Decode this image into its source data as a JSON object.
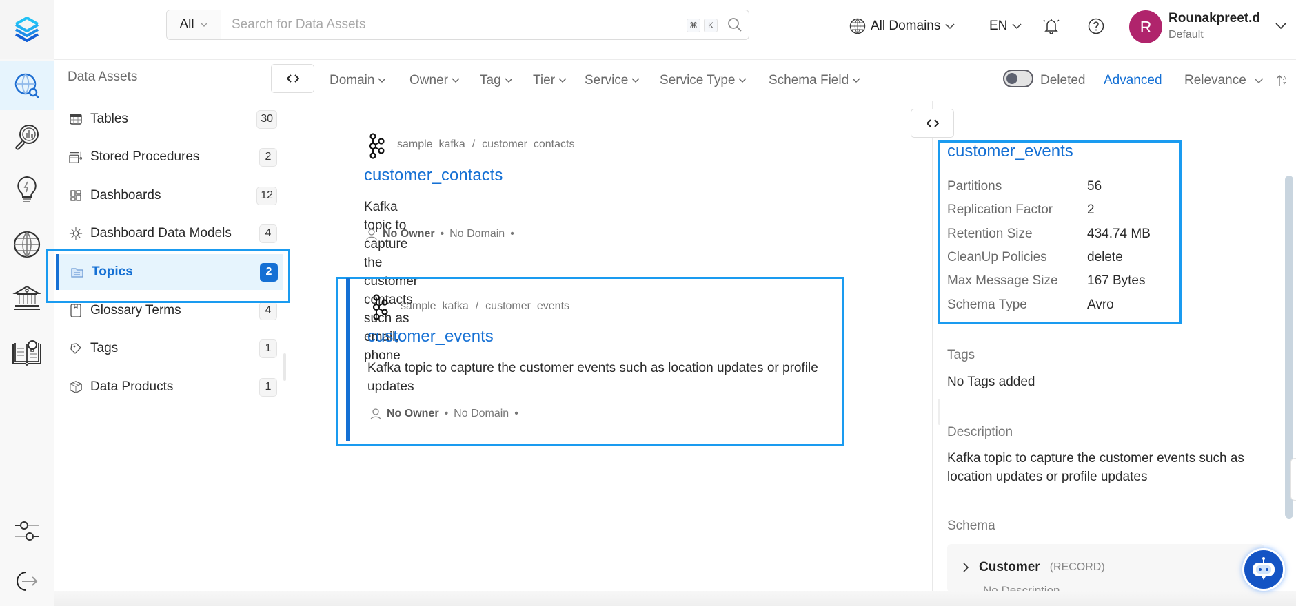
{
  "header": {
    "search_type": "All",
    "search_placeholder": "Search for Data Assets",
    "search_value": "",
    "shortcut_keys": [
      "⌘",
      "K"
    ],
    "domain_selector": "All Domains",
    "language": "EN",
    "user": {
      "initial": "R",
      "name": "Rounakpreet.d",
      "role": "Default",
      "avatar_color": "#b0246c"
    }
  },
  "rail": {
    "items": [
      {
        "icon": "explore-icon",
        "active": true
      },
      {
        "icon": "data-insights-icon",
        "active": false
      },
      {
        "icon": "data-quality-icon",
        "active": false
      },
      {
        "icon": "domains-icon",
        "active": false
      },
      {
        "icon": "governance-icon",
        "active": false
      },
      {
        "icon": "knowledge-center-icon",
        "active": false
      }
    ],
    "bottom_items": [
      {
        "icon": "settings-sliders-icon"
      },
      {
        "icon": "logout-icon"
      }
    ]
  },
  "sidebar": {
    "title": "Data Assets",
    "items": [
      {
        "label": "Tables",
        "count": "30",
        "icon": "table-icon",
        "active": false
      },
      {
        "label": "Stored Procedures",
        "count": "2",
        "icon": "stored-procedure-icon",
        "active": false
      },
      {
        "label": "Dashboards",
        "count": "12",
        "icon": "dashboard-icon",
        "active": false
      },
      {
        "label": "Dashboard Data Models",
        "count": "4",
        "icon": "data-model-icon",
        "active": false
      },
      {
        "label": "Topics",
        "count": "2",
        "icon": "topic-icon",
        "active": true
      },
      {
        "label": "Glossary Terms",
        "count": "4",
        "icon": "glossary-icon",
        "active": false
      },
      {
        "label": "Tags",
        "count": "1",
        "icon": "tag-icon",
        "active": false
      },
      {
        "label": "Data Products",
        "count": "1",
        "icon": "data-product-icon",
        "active": false
      }
    ]
  },
  "filters": {
    "items": [
      "Domain",
      "Owner",
      "Tag",
      "Tier",
      "Service",
      "Service Type",
      "Schema Field"
    ],
    "deleted_label": "Deleted",
    "deleted_on": false,
    "advanced_label": "Advanced",
    "sort_label": "Relevance"
  },
  "results": [
    {
      "service": "sample_kafka",
      "separator": "/",
      "name": "customer_contacts",
      "title": "customer_contacts",
      "description": "Kafka topic to capture the customer contacts such as email, phone",
      "owner": "No Owner",
      "domain": "No Domain",
      "selected": false
    },
    {
      "service": "sample_kafka",
      "separator": "/",
      "name": "customer_events",
      "title": "customer_events",
      "description": "Kafka topic to capture the customer events such as location updates or profile updates",
      "owner": "No Owner",
      "domain": "No Domain",
      "selected": true
    }
  ],
  "detail": {
    "title": "customer_events",
    "properties": [
      {
        "key": "Partitions",
        "value": "56"
      },
      {
        "key": "Replication Factor",
        "value": "2"
      },
      {
        "key": "Retention Size",
        "value": "434.74 MB"
      },
      {
        "key": "CleanUp Policies",
        "value": "delete"
      },
      {
        "key": "Max Message Size",
        "value": "167 Bytes"
      },
      {
        "key": "Schema Type",
        "value": "Avro"
      }
    ],
    "tags_label": "Tags",
    "tags_value": "No Tags added",
    "description_label": "Description",
    "description_value": "Kafka topic to capture the customer events such as location updates or profile updates",
    "schema_label": "Schema",
    "schema_fields": [
      {
        "name": "Customer",
        "type": "(RECORD)",
        "description": "No Description"
      }
    ]
  },
  "colors": {
    "accent": "#1570d4",
    "highlight_border": "#1a9bf0",
    "active_bg": "#e6f4fd"
  }
}
